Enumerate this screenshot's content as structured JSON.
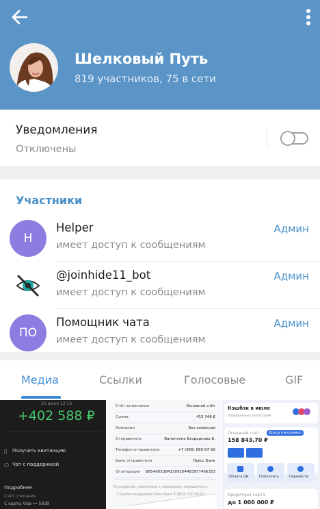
{
  "header": {
    "title": "Шелковый Путь",
    "subtitle": "819 участников, 75 в сети",
    "back_icon": "arrow-left-icon",
    "more_icon": "more-vertical-icon",
    "colors": {
      "bar": "#5b95c8",
      "title": "#ffffff"
    }
  },
  "notifications": {
    "label": "Уведомления",
    "state": "Отключены",
    "toggle_on": false
  },
  "members": {
    "title": "Участники",
    "items": [
      {
        "initials": "H",
        "name": "Helper",
        "status": "имеет доступ к сообщениям",
        "role": "Админ"
      },
      {
        "initials": "",
        "name": "@joinhide11_bot",
        "status": "имеет доступ к сообщениям",
        "role": "Админ"
      },
      {
        "initials": "ПО",
        "name": "Помощник чата",
        "status": "имеет доступ к сообщениям",
        "role": "Админ"
      }
    ]
  },
  "tabs": [
    "Медиа",
    "Ссылки",
    "Голосовые",
    "GIF"
  ],
  "active_tab": "Медиа",
  "media": {
    "m1": {
      "balance": "+402 588 ₽",
      "top": "20 июня 12:16",
      "actions": [
        "Получить квитанцию",
        "Чат с поддержкой"
      ],
      "details_title": "Подробнее",
      "details_lines": [
        "Счёт списания",
        "С карты Visa •• 5039"
      ]
    },
    "m2": {
      "rows": [
        [
          "Счёт зачисления",
          "Основной счёт"
        ],
        [
          "Сумма",
          "453 346 ₽"
        ],
        [
          "Комиссия",
          "Без комиссии"
        ],
        [
          "Отправитель",
          "Валентина Безроднова Б."
        ],
        [
          "Телефон отправителя",
          "+7 (965) 689-97-92"
        ],
        [
          "Банк отправителя",
          "Пресс Банк"
        ],
        [
          "ID операции",
          "B6549053B41509204483977466353"
        ]
      ],
      "footer1": "По вопросам, связанным с переводом, обращайтесь",
      "footer2": "Служба поддержки Озон Банк 8 (800) 100-85-02"
    },
    "m3": {
      "cashback_title": "Кэшбэк в июле",
      "cashback_sub": "0 выбранных категорий",
      "account_label": "Основной счёт",
      "account_badge": "Доход ежедневно",
      "account_amount": "158 843,70 ₽",
      "actions": [
        "Оплата QR",
        "Пополнить",
        "Перевести"
      ],
      "credit_label": "Кредитная карта",
      "credit_amount": "до 1 000 000 ₽"
    }
  }
}
